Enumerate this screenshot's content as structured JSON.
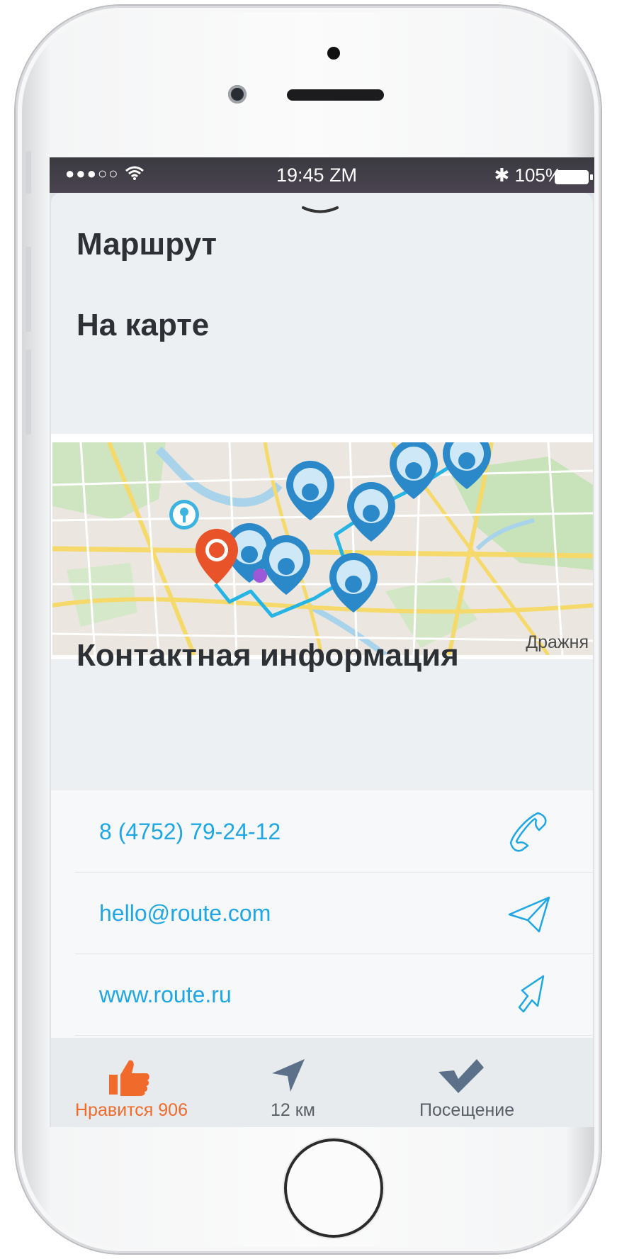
{
  "status_bar": {
    "signal": "●●●○○",
    "wifi_icon": "wifi-icon",
    "time": "19:45 ZM",
    "bluetooth": "✱",
    "battery": "105%"
  },
  "sections": {
    "route_title": "Маршрут",
    "map_title": "На карте",
    "contacts_title": "Контактная информация"
  },
  "map": {
    "place_label": "Дражня"
  },
  "contacts": [
    {
      "value": "8 (4752) 79-24-12",
      "icon": "phone-icon"
    },
    {
      "value": "hello@route.com",
      "icon": "send-icon"
    },
    {
      "value": "www.route.ru",
      "icon": "cursor-icon"
    }
  ],
  "tabs": {
    "like": {
      "label": "Нравится 906",
      "color": "#f06a2b",
      "icon": "thumbs-up-icon"
    },
    "distance": {
      "label": "12 км",
      "icon": "navigation-icon"
    },
    "visit": {
      "label": "Посещение",
      "icon": "checkmark-icon"
    }
  },
  "colors": {
    "accent_blue": "#1fa7e5",
    "marker_blue": "#2c89c9",
    "marker_orange": "#e8532a"
  }
}
